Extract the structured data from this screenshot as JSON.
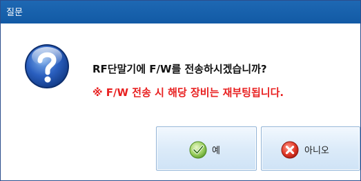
{
  "window": {
    "title": "질문"
  },
  "message": {
    "line1": "RF단말기에 F/W를 전송하시겠습니까?",
    "line2": "※ F/W 전송 시 해당 장비는 재부팅됩니다."
  },
  "icons": {
    "dialog": "question-icon",
    "yes": "checkmark-icon",
    "no": "cancel-x-icon"
  },
  "buttons": {
    "yes_label": "예",
    "no_label": "아니오"
  },
  "colors": {
    "titlebar": "#1565b0",
    "warning_text": "#e82020",
    "button_border": "#8fb2d6"
  }
}
